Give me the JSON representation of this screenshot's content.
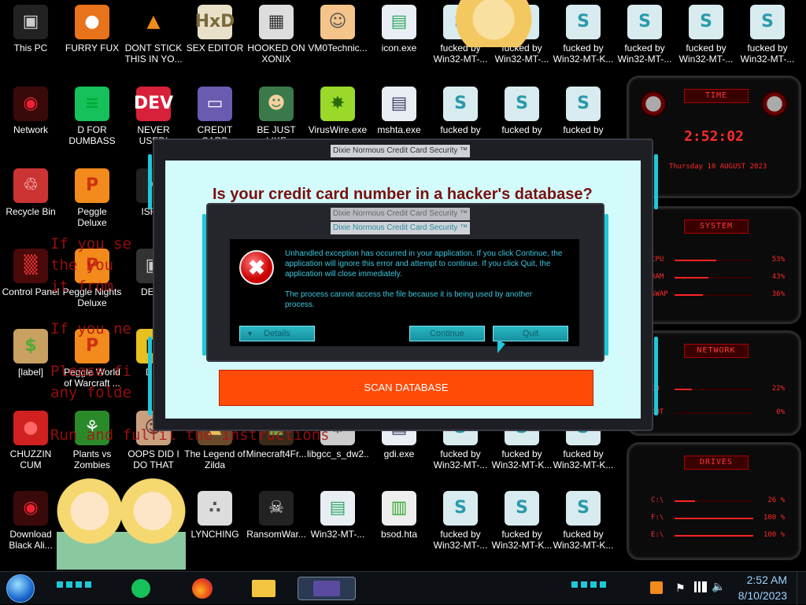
{
  "desktop": {
    "icons": [
      {
        "label": "This PC",
        "glyph": "▣",
        "color": "#222",
        "fg": "#ccc"
      },
      {
        "label": "FURRY FUX",
        "glyph": "●",
        "color": "#e8731a",
        "fg": "#fff"
      },
      {
        "label": "DONT STICK THIS IN YO...",
        "glyph": "▲",
        "color": "#000",
        "fg": "#f28a1c"
      },
      {
        "label": "SEX EDITOR",
        "glyph": "HxD",
        "color": "#e8e0c8",
        "fg": "#7a6a3a"
      },
      {
        "label": "HOOKED ON XONIX",
        "glyph": "▦",
        "color": "#ddd",
        "fg": "#333"
      },
      {
        "label": "VM0Technic...",
        "glyph": "☺",
        "color": "#f4c48a",
        "fg": "#555"
      },
      {
        "label": "icon.exe",
        "glyph": "▤",
        "color": "#e8eef4",
        "fg": "#3a6"
      },
      {
        "label": "fucked by Win32-MT-...",
        "glyph": "S",
        "color": "#d8ecf0",
        "fg": "#2a9aaa"
      },
      {
        "label": "fucked by Win32-MT-...",
        "glyph": "S",
        "color": "#d8ecf0",
        "fg": "#2a9aaa"
      },
      {
        "label": "fucked by Win32-MT-K...",
        "glyph": "S",
        "color": "#d8ecf0",
        "fg": "#2a9aaa"
      },
      {
        "label": "fucked by Win32-MT-...",
        "glyph": "S",
        "color": "#d8ecf0",
        "fg": "#2a9aaa"
      },
      {
        "label": "fucked by Win32-MT-...",
        "glyph": "S",
        "color": "#d8ecf0",
        "fg": "#2a9aaa"
      },
      {
        "label": "fucked by Win32-MT-...",
        "glyph": "S",
        "color": "#d8ecf0",
        "fg": "#2a9aaa"
      },
      {
        "label": "Network",
        "glyph": "◉",
        "color": "#3a0a0a",
        "fg": "#e23"
      },
      {
        "label": "D FOR DUMBASS",
        "glyph": "≡",
        "color": "#16c05a",
        "fg": "#0a3"
      },
      {
        "label": "NEVER USED!",
        "glyph": "DEV",
        "color": "#d8203a",
        "fg": "#fff"
      },
      {
        "label": "CREDIT CARD",
        "glyph": "▭",
        "color": "#6a5ab0",
        "fg": "#fff"
      },
      {
        "label": "BE JUST LIKE",
        "glyph": "☻",
        "color": "#3a7a4a",
        "fg": "#f4d0a0"
      },
      {
        "label": "VirusWire.exe",
        "glyph": "✸",
        "color": "#9ad82a",
        "fg": "#2a6a0a"
      },
      {
        "label": "mshta.exe",
        "glyph": "▤",
        "color": "#e8eef4",
        "fg": "#446"
      },
      {
        "label": "fucked by",
        "glyph": "S",
        "color": "#d8ecf0",
        "fg": "#2a9aaa"
      },
      {
        "label": "fucked by",
        "glyph": "S",
        "color": "#d8ecf0",
        "fg": "#2a9aaa"
      },
      {
        "label": "fucked by",
        "glyph": "S",
        "color": "#d8ecf0",
        "fg": "#2a9aaa"
      },
      {
        "label": "Recycle Bin",
        "glyph": "♲",
        "color": "#c33",
        "fg": "#fff"
      },
      {
        "label": "Peggle Deluxe",
        "glyph": "P",
        "color": "#f28a1c",
        "fg": "#c31"
      },
      {
        "label": "ISRAI",
        "glyph": "✶",
        "color": "#222",
        "fg": "#aaa"
      },
      {
        "label": "Control Panel",
        "glyph": "▒",
        "color": "#4a0a0a",
        "fg": "#e33"
      },
      {
        "label": "Peggle Nights Deluxe",
        "glyph": "P",
        "color": "#f28a1c",
        "fg": "#c31"
      },
      {
        "label": "DEEZ",
        "glyph": "▣",
        "color": "#333",
        "fg": "#ccc"
      },
      {
        "label": "[label]",
        "glyph": "$",
        "color": "#c8a060",
        "fg": "#5a3"
      },
      {
        "label": "Peggle World of Warcraft ...",
        "glyph": "P",
        "color": "#f28a1c",
        "fg": "#c31"
      },
      {
        "label": "DIE",
        "glyph": "▦",
        "color": "#e8c020",
        "fg": "#000"
      },
      {
        "label": "CHUZZIN CUM",
        "glyph": "●",
        "color": "#d02020",
        "fg": "#f66"
      },
      {
        "label": "Plants vs Zombies",
        "glyph": "⚘",
        "color": "#2a8a2a",
        "fg": "#fff"
      },
      {
        "label": "OOPS DID I DO THAT",
        "glyph": "☺",
        "color": "#c8a080",
        "fg": "#533"
      },
      {
        "label": "The Legend of Zilda",
        "glyph": "▲",
        "color": "#6a4a2a",
        "fg": "#e8c060"
      },
      {
        "label": "Minecraft4Fr...",
        "glyph": "■",
        "color": "#3a2a1a",
        "fg": "#6a4"
      },
      {
        "label": "libgcc_s_dw2...",
        "glyph": "⚙",
        "color": "#ccc",
        "fg": "#666"
      },
      {
        "label": "gdi.exe",
        "glyph": "▤",
        "color": "#e8eef4",
        "fg": "#446"
      },
      {
        "label": "fucked by Win32-MT-...",
        "glyph": "S",
        "color": "#d8ecf0",
        "fg": "#2a9aaa"
      },
      {
        "label": "fucked by Win32-MT-K...",
        "glyph": "S",
        "color": "#d8ecf0",
        "fg": "#2a9aaa"
      },
      {
        "label": "fucked by Win32-MT-K...",
        "glyph": "S",
        "color": "#d8ecf0",
        "fg": "#2a9aaa"
      },
      {
        "label": "Download Black Ali...",
        "glyph": "◉",
        "color": "#3a0a0a",
        "fg": "#e23"
      },
      {
        "label": "LYNCHING",
        "glyph": "∴",
        "color": "#ddd",
        "fg": "#555"
      },
      {
        "label": "RansomWar...",
        "glyph": "☠",
        "color": "#222",
        "fg": "#eee"
      },
      {
        "label": "Win32-MT-...",
        "glyph": "▤",
        "color": "#e8eef4",
        "fg": "#3a6"
      },
      {
        "label": "bsod.hta",
        "glyph": "▥",
        "color": "#eee",
        "fg": "#3a3"
      },
      {
        "label": "fucked by Win32-MT-...",
        "glyph": "S",
        "color": "#d8ecf0",
        "fg": "#2a9aaa"
      },
      {
        "label": "fucked by Win32-MT-K...",
        "glyph": "S",
        "color": "#d8ecf0",
        "fg": "#2a9aaa"
      },
      {
        "label": "fucked by Win32-MT-K...",
        "glyph": "S",
        "color": "#d8ecf0",
        "fg": "#2a9aaa"
      }
    ],
    "bg_lines": [
      "If you se",
      "the you",
      "it from",
      "If you ne",
      "Please fi",
      "any folde",
      "Run and fulfil the instructions"
    ]
  },
  "gadgets": {
    "time": {
      "title": "TIME",
      "clock": "2:52:02",
      "date": "Thursday 10 AUGUST 2023"
    },
    "system": {
      "title": "SYSTEM",
      "rows": [
        {
          "label": "CPU",
          "value": "53%",
          "pct": 0.53
        },
        {
          "label": "RAM",
          "value": "43%",
          "pct": 0.43
        },
        {
          "label": "SWAP",
          "value": "36%",
          "pct": 0.36
        }
      ]
    },
    "network": {
      "title": "NETWORK",
      "rows": [
        {
          "label": "IN",
          "value": "22%",
          "pct": 0.22
        },
        {
          "label": "OUT",
          "value": "0%",
          "pct": 0.0
        }
      ]
    },
    "drives": {
      "title": "DRIVES",
      "rows": [
        {
          "label": "C:\\",
          "value": "26 %",
          "pct": 0.26
        },
        {
          "label": "F:\\",
          "value": "100 %",
          "pct": 1.0
        },
        {
          "label": "E:\\",
          "value": "100 %",
          "pct": 1.0
        }
      ]
    }
  },
  "main_window": {
    "title": "Dixie Normous Credit Card Security ™",
    "headline": "Is your credit card number in a hacker's database?",
    "scan_button": "SCAN DATABASE"
  },
  "dialog": {
    "title_back": "Dixie Normous Credit Card Security ™",
    "title": "Dixie Normous Credit Card Security ™",
    "message1": "Unhandled exception has occurred in your application. If you click Continue, the application will ignore this error and attempt to continue. If you click Quit, the application will close immediately.",
    "message2": "The process cannot access the file because it is being used by another process.",
    "details": "Details",
    "continue": "Continue",
    "quit": "Quit"
  },
  "taskbar": {
    "time": "2:52 AM",
    "date": "8/10/2023",
    "accent": "#1fc8d8"
  }
}
